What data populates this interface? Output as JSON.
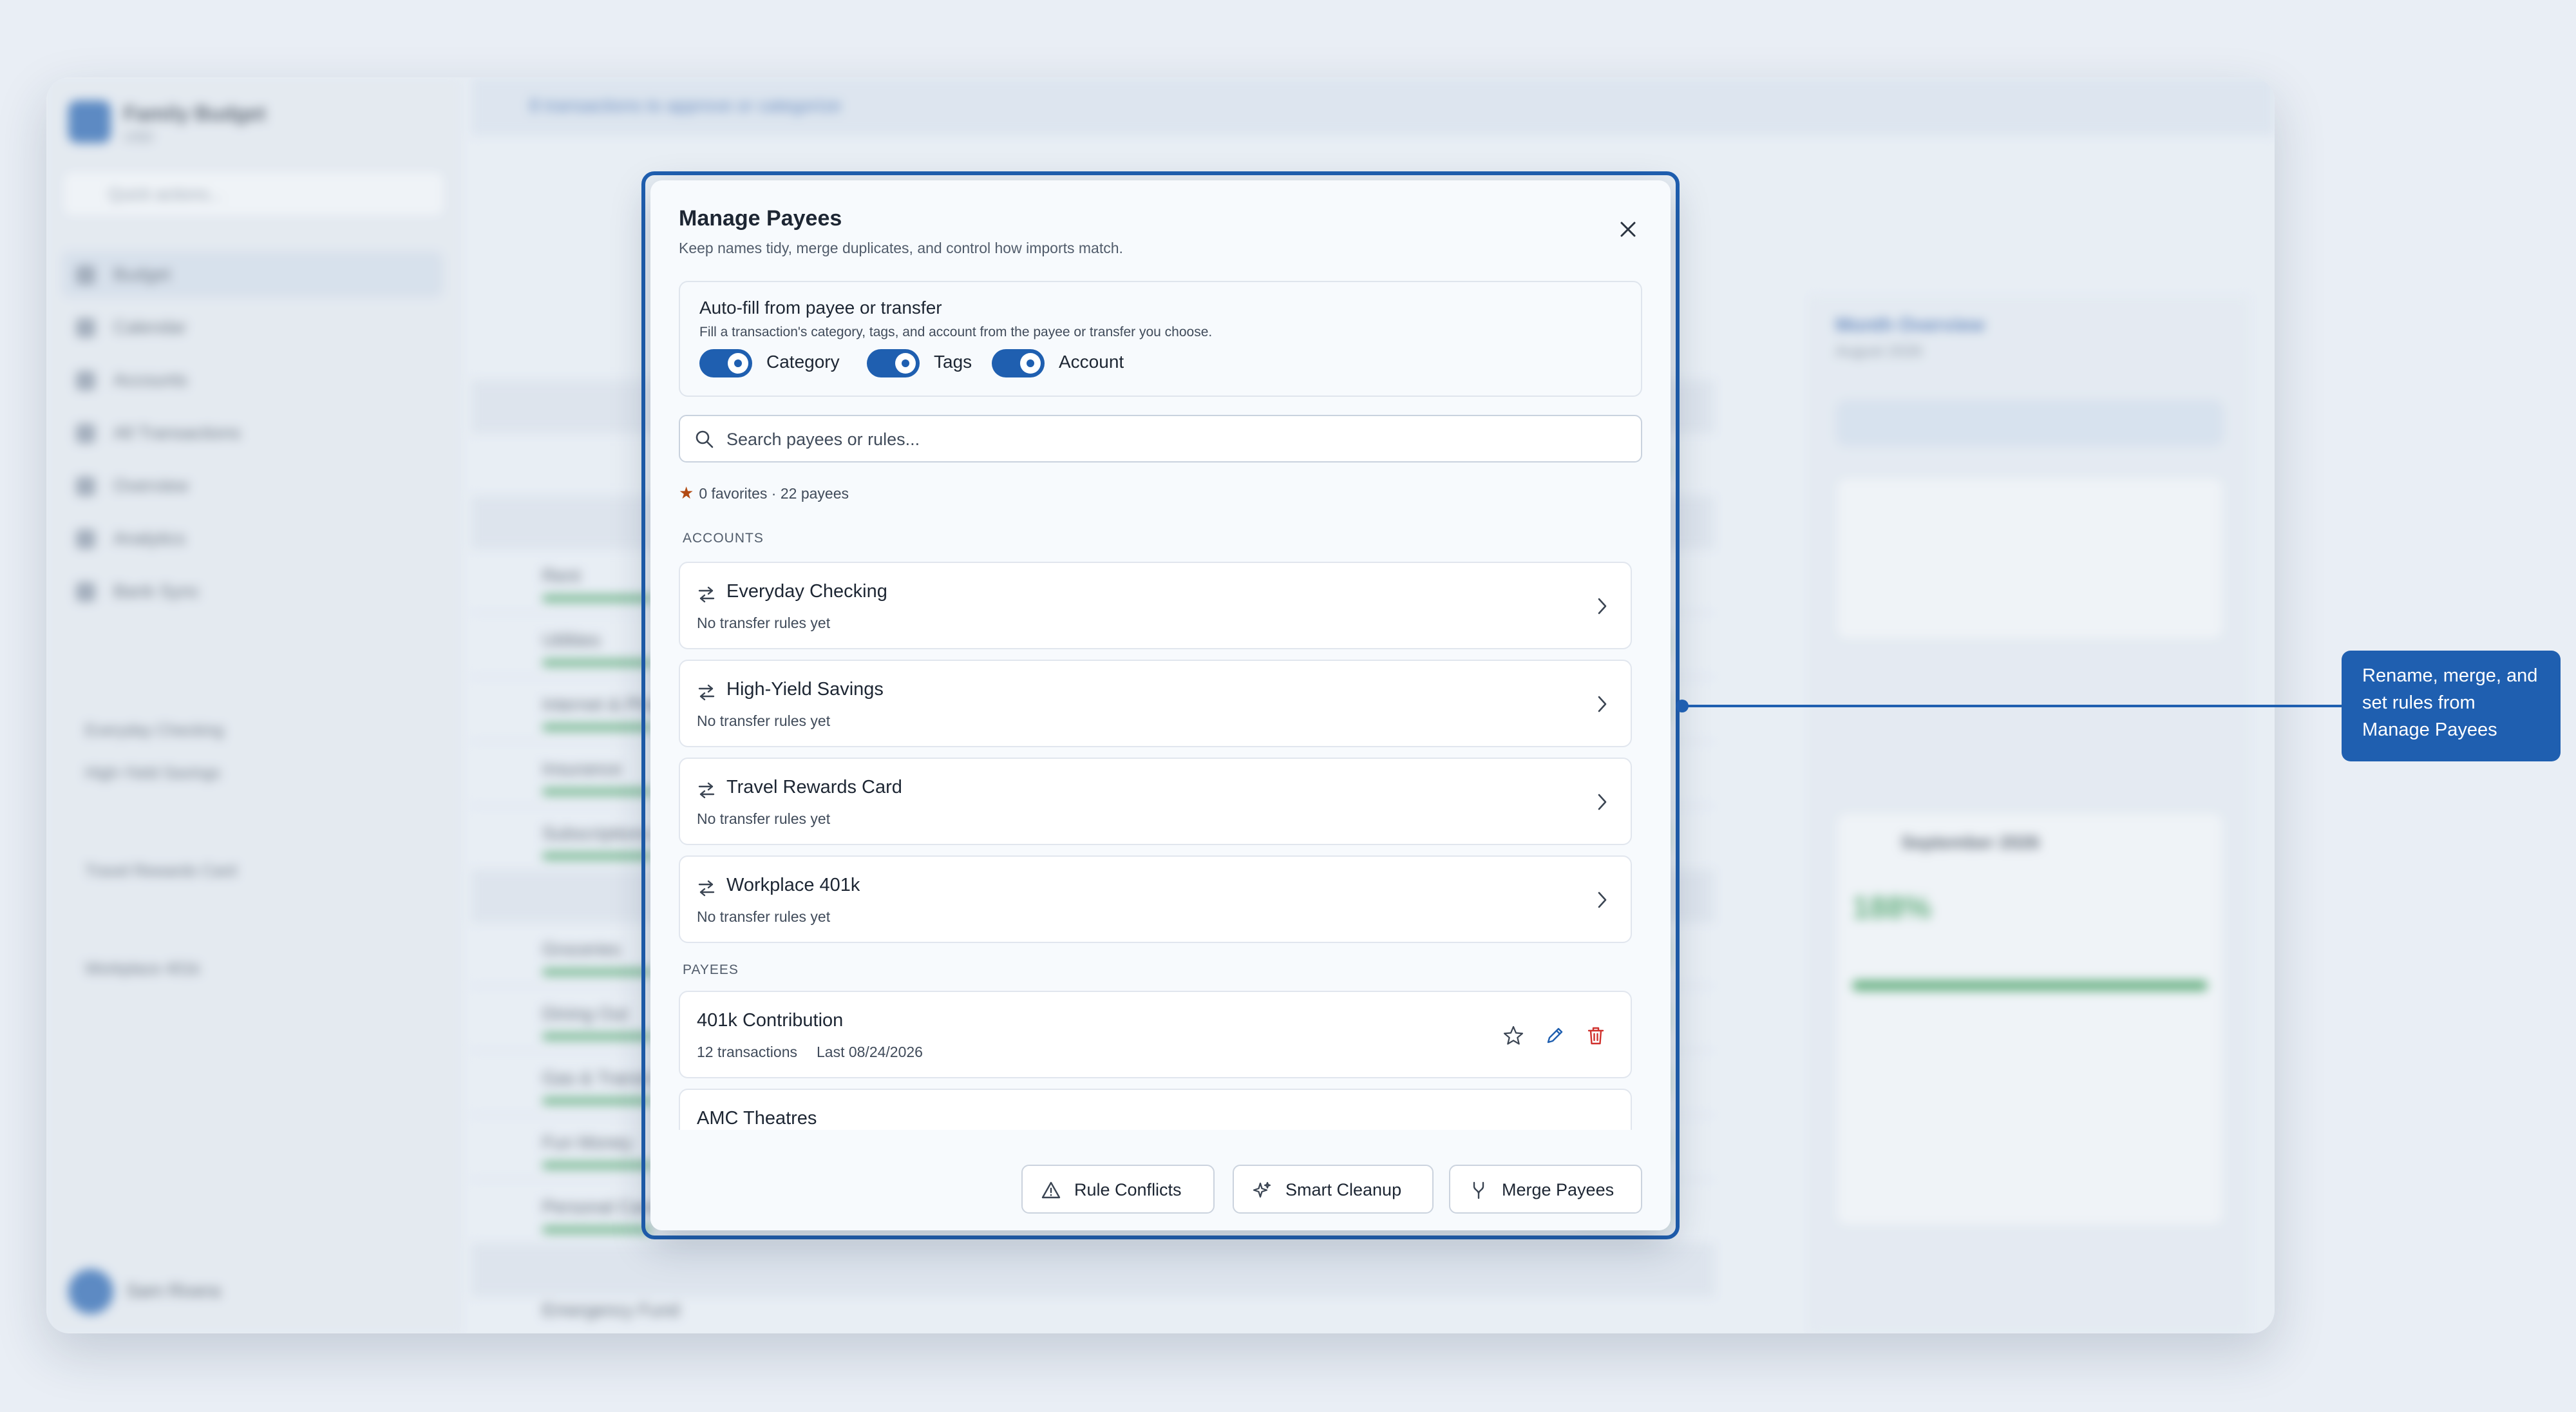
{
  "background_app": {
    "app_name": "Family Budget",
    "currency": "USD",
    "quick_actions_placeholder": "Quick actions...",
    "nav": [
      "Budget",
      "Calendar",
      "Accounts",
      "All Transactions",
      "Overview",
      "Analytics",
      "Bank Sync"
    ],
    "accounts": [
      "Everyday Checking",
      "High-Yield Savings",
      "Travel Rewards Card",
      "Workplace 401k"
    ],
    "user_name": "Sam Rivera",
    "banner": "8 transactions to approve or categorize",
    "budget_rows": [
      "Rent",
      "Utilities",
      "Internet & Phone",
      "Insurance",
      "Subscriptions",
      "Groceries",
      "Dining Out",
      "Gas & Transit",
      "Fun Money",
      "Personal Care",
      "Emergency Fund"
    ],
    "right_panel_title": "Month Overview",
    "right_panel_sub": "August 2026",
    "right_panel_card_title": "September 2026",
    "right_panel_percent": "188%"
  },
  "modal": {
    "title": "Manage Payees",
    "subtitle": "Keep names tidy, merge duplicates, and control how imports match.",
    "autofill": {
      "title": "Auto-fill from payee or transfer",
      "description": "Fill a transaction's category, tags, and account from the payee or transfer you choose.",
      "toggles": [
        {
          "label": "Category",
          "on": true
        },
        {
          "label": "Tags",
          "on": true
        },
        {
          "label": "Account",
          "on": true
        }
      ]
    },
    "search_placeholder": "Search payees or rules...",
    "stats": "0 favorites · 22 payees",
    "accounts_heading": "ACCOUNTS",
    "accounts": [
      {
        "name": "Everyday Checking",
        "meta": "No transfer rules yet"
      },
      {
        "name": "High-Yield Savings",
        "meta": "No transfer rules yet"
      },
      {
        "name": "Travel Rewards Card",
        "meta": "No transfer rules yet"
      },
      {
        "name": "Workplace 401k",
        "meta": "No transfer rules yet"
      }
    ],
    "payees_heading": "PAYEES",
    "payees": [
      {
        "name": "401k Contribution",
        "transactions": "12 transactions",
        "last": "Last 08/24/2026"
      },
      {
        "name": "AMC Theatres",
        "transactions": "",
        "last": ""
      }
    ],
    "footer": {
      "rule_conflicts": "Rule Conflicts",
      "smart_cleanup": "Smart Cleanup",
      "merge_payees": "Merge Payees"
    }
  },
  "callout": {
    "text": "Rename, merge, and set rules from Manage Payees"
  },
  "colors": {
    "accent": "#1f5fb0",
    "star": "#b24a12",
    "delete": "#d0312d",
    "positive": "#2f9a4c"
  },
  "icons": [
    "close-icon",
    "search-icon",
    "star-icon",
    "transfer-icon",
    "chevron-right-icon",
    "edit-icon",
    "delete-icon",
    "warning-icon",
    "sparkle-icon",
    "merge-icon"
  ]
}
